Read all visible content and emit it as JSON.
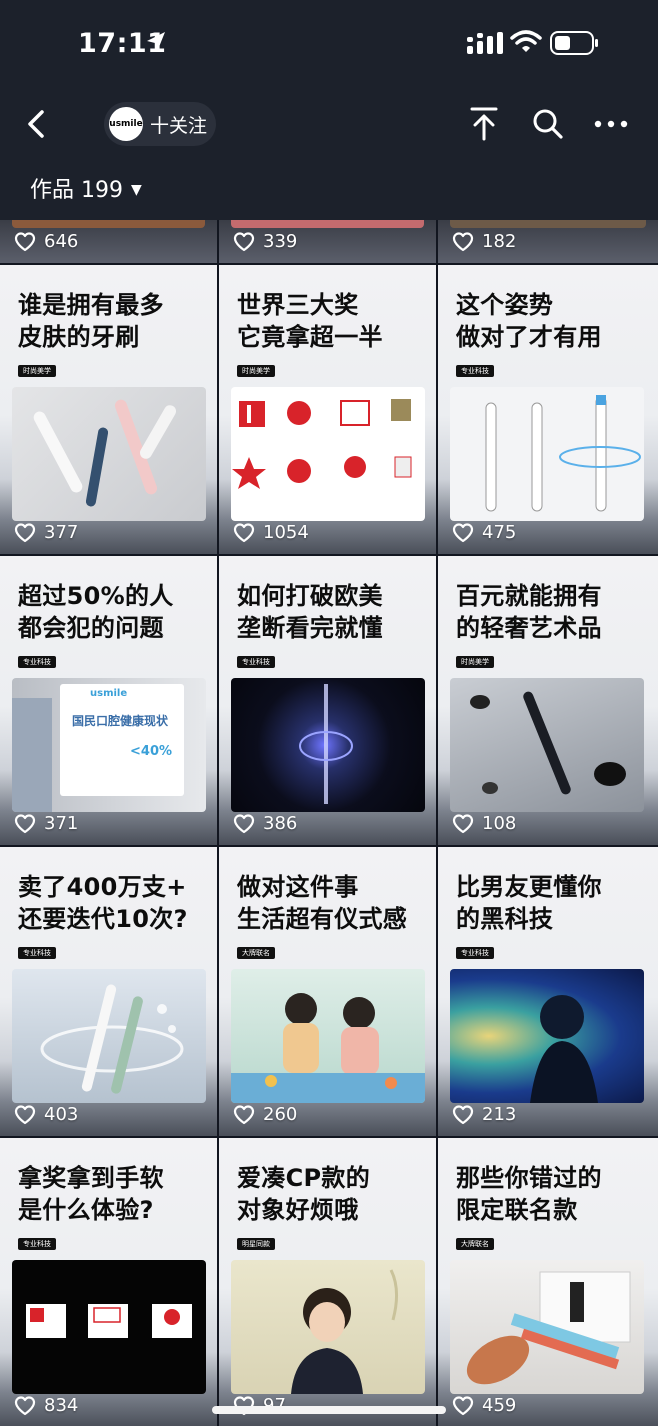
{
  "status_bar": {
    "time": "17:11"
  },
  "header": {
    "brand_logo_text": "usmile",
    "follow_label": "十关注",
    "works_tab": "作品 199"
  },
  "partial_row": [
    {
      "likes": "646",
      "strip_color": "#8b5a3c"
    },
    {
      "likes": "339",
      "strip_color": "#c46b6e"
    },
    {
      "likes": "182",
      "strip_color": "#6d5a48"
    }
  ],
  "videos": [
    {
      "title_l1": "谁是拥有最多",
      "title_l2": "皮肤的牙刷",
      "tag": "时尚美学",
      "likes": "377"
    },
    {
      "title_l1": "世界三大奖",
      "title_l2": "它竟拿超一半",
      "tag": "时尚美学",
      "likes": "1054"
    },
    {
      "title_l1": "这个姿势",
      "title_l2": "做对了才有用",
      "tag": "专业科技",
      "likes": "475"
    },
    {
      "title_l1": "超过50%的人",
      "title_l2": "都会犯的问题",
      "tag": "专业科技",
      "likes": "371",
      "img_brand": "usmile",
      "img_heading": "国民口腔健康现状",
      "img_stat": "<40%"
    },
    {
      "title_l1": "如何打破欧美",
      "title_l2": "垄断看完就懂",
      "tag": "专业科技",
      "likes": "386"
    },
    {
      "title_l1": "百元就能拥有",
      "title_l2": "的轻奢艺术品",
      "tag": "时尚美学",
      "likes": "108"
    },
    {
      "title_l1": "卖了400万支+",
      "title_l2": "还要迭代10次?",
      "tag": "专业科技",
      "likes": "403"
    },
    {
      "title_l1": "做对这件事",
      "title_l2": "生活超有仪式感",
      "tag": "大牌联名",
      "likes": "260"
    },
    {
      "title_l1": "比男友更懂你",
      "title_l2": "的黑科技",
      "tag": "专业科技",
      "likes": "213"
    },
    {
      "title_l1": "拿奖拿到手软",
      "title_l2": "是什么体验?",
      "tag": "专业科技",
      "likes": "834"
    },
    {
      "title_l1": "爱凑CP款的",
      "title_l2": "对象好烦哦",
      "tag": "明星同款",
      "likes": "97"
    },
    {
      "title_l1": "那些你错过的",
      "title_l2": "限定联名款",
      "tag": "大牌联名",
      "likes": "459"
    }
  ],
  "colors": {
    "header_bg": "#1c212b",
    "grid_bg": "#121620",
    "tag_bg": "#111111"
  }
}
